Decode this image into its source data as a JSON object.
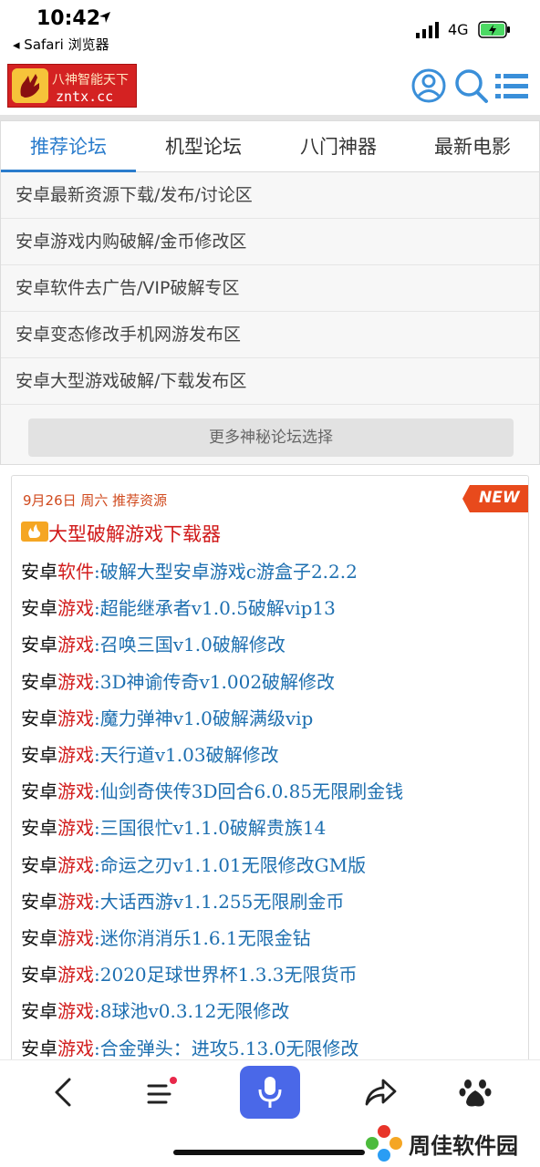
{
  "status_bar": {
    "time": "10:42",
    "back_app": "◂ Safari 浏览器",
    "network": "4G"
  },
  "header": {
    "logo_name": "八神智能天下",
    "logo_domain": "zntx.cc"
  },
  "tabs": [
    {
      "label": "推荐论坛",
      "active": true
    },
    {
      "label": "机型论坛",
      "active": false
    },
    {
      "label": "八门神器",
      "active": false
    },
    {
      "label": "最新电影",
      "active": false
    }
  ],
  "forums": [
    "安卓最新资源下载/发布/讨论区",
    "安卓游戏内购破解/金币修改区",
    "安卓软件去广告/VIP破解专区",
    "安卓变态修改手机网游发布区",
    "安卓大型游戏破解/下载发布区"
  ],
  "more_button": "更多神秘论坛选择",
  "resources": {
    "date_label": "9月26日 周六 推荐资源",
    "badge": "NEW",
    "headline": "大型破解游戏下载器",
    "items": [
      {
        "prefix": "安卓",
        "category": "软件",
        "title": ":破解大型安卓游戏c游盒子2.2.2"
      },
      {
        "prefix": "安卓",
        "category": "游戏",
        "title": ":超能继承者v1.0.5破解vip13"
      },
      {
        "prefix": "安卓",
        "category": "游戏",
        "title": ":召唤三国v1.0破解修改"
      },
      {
        "prefix": "安卓",
        "category": "游戏",
        "title": ":3D神谕传奇v1.002破解修改"
      },
      {
        "prefix": "安卓",
        "category": "游戏",
        "title": ":魔力弹神v1.0破解满级vip"
      },
      {
        "prefix": "安卓",
        "category": "游戏",
        "title": ":天行道v1.03破解修改"
      },
      {
        "prefix": "安卓",
        "category": "游戏",
        "title": ":仙剑奇侠传3D回合6.0.85无限刷金钱"
      },
      {
        "prefix": "安卓",
        "category": "游戏",
        "title": ":三国很忙v1.1.0破解贵族14"
      },
      {
        "prefix": "安卓",
        "category": "游戏",
        "title": ":命运之刃v1.1.01无限修改GM版"
      },
      {
        "prefix": "安卓",
        "category": "游戏",
        "title": ":大话西游v1.1.255无限刷金币"
      },
      {
        "prefix": "安卓",
        "category": "游戏",
        "title": ":迷你消消乐1.6.1无限金钻"
      },
      {
        "prefix": "安卓",
        "category": "游戏",
        "title": ":2020足球世界杯1.3.3无限货币"
      },
      {
        "prefix": "安卓",
        "category": "游戏",
        "title": ":8球池v0.3.12无限修改"
      },
      {
        "prefix": "安卓",
        "category": "游戏",
        "title": ":合金弹头：进攻5.13.0无限修改"
      }
    ]
  },
  "watermark": "周佳软件园",
  "colors": {
    "accent_blue": "#2a7ccc",
    "category_red": "#d21c1c",
    "link_blue": "#1d6fb0",
    "voice_button": "#4a68e8",
    "logo_red": "#d42222"
  }
}
